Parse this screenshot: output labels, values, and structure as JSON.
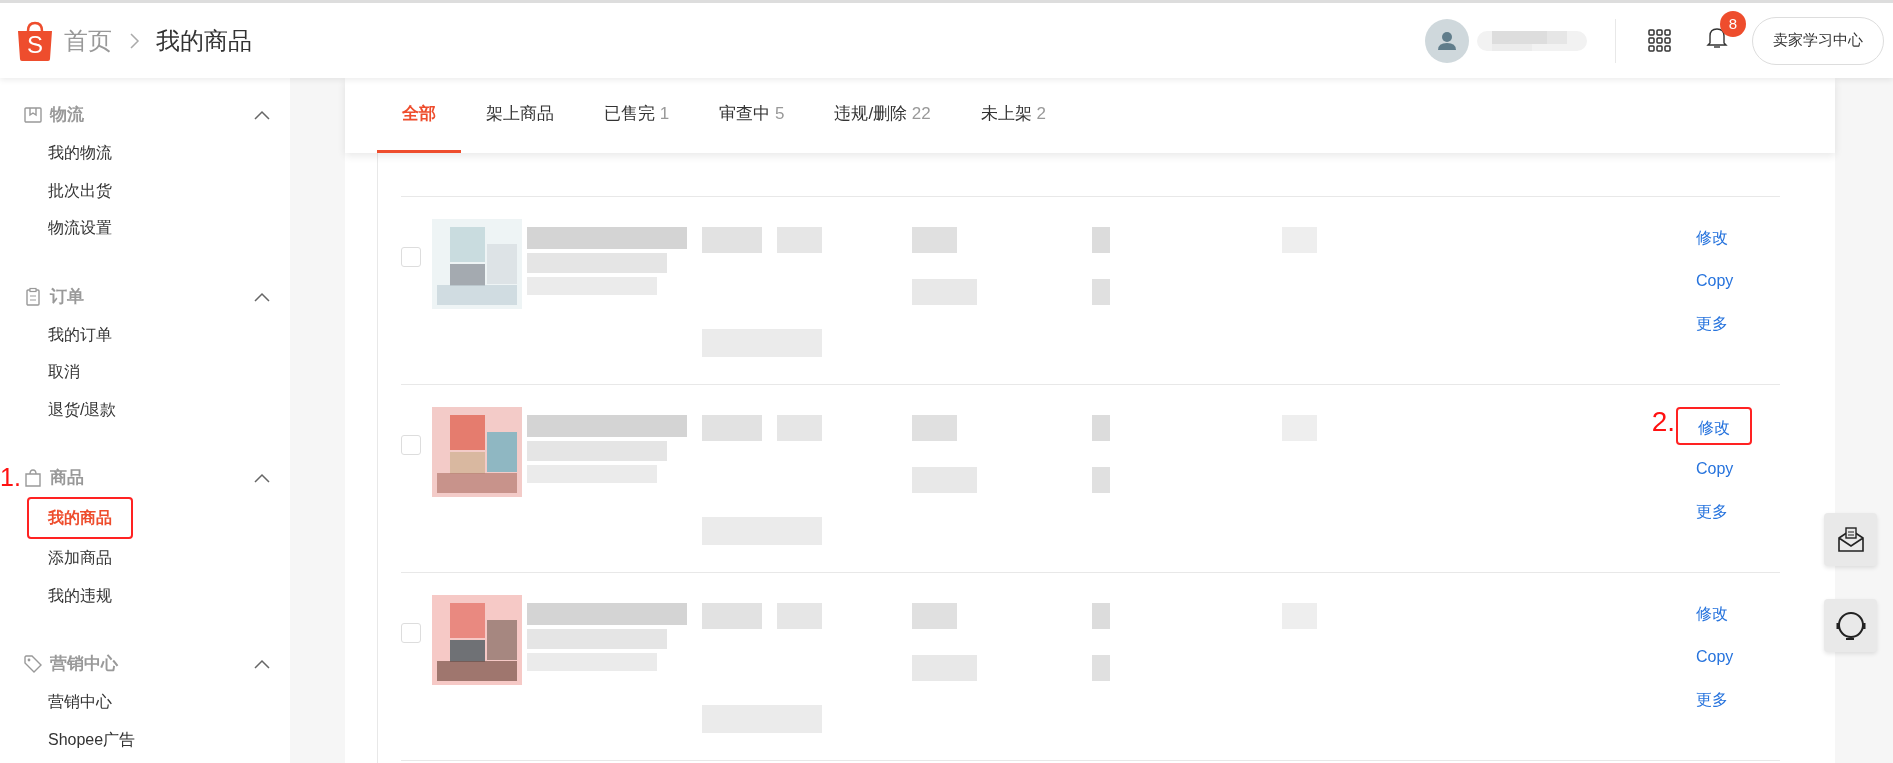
{
  "header": {
    "logo": "S",
    "breadcrumb": [
      {
        "label": "首页"
      },
      {
        "label": "我的商品"
      }
    ],
    "notification_count": "8",
    "learning_button": "卖家学习中心"
  },
  "sidebar": {
    "sections": [
      {
        "kind": "logistics",
        "title": "物流",
        "expanded": true,
        "items": [
          {
            "label": "我的物流",
            "selected": false
          },
          {
            "label": "批次出货",
            "selected": false
          },
          {
            "label": "物流设置",
            "selected": false
          }
        ]
      },
      {
        "kind": "orders",
        "title": "订单",
        "expanded": true,
        "items": [
          {
            "label": "我的订单",
            "selected": false
          },
          {
            "label": "取消",
            "selected": false
          },
          {
            "label": "退货/退款",
            "selected": false
          }
        ]
      },
      {
        "kind": "products",
        "title": "商品",
        "expanded": true,
        "annotation": "1.",
        "items": [
          {
            "label": "我的商品",
            "selected": true,
            "boxed": true
          },
          {
            "label": "添加商品",
            "selected": false
          },
          {
            "label": "我的违规",
            "selected": false
          }
        ]
      },
      {
        "kind": "marketing",
        "title": "营销中心",
        "expanded": true,
        "items": [
          {
            "label": "营销中心",
            "selected": false
          },
          {
            "label": "Shopee广告",
            "selected": false
          }
        ]
      }
    ]
  },
  "tabs": [
    {
      "label": "全部",
      "selected": true
    },
    {
      "label": "架上商品",
      "selected": false
    },
    {
      "label": "已售完",
      "count": "1",
      "selected": false
    },
    {
      "label": "审查中",
      "count": "5",
      "selected": false
    },
    {
      "label": "违规/删除",
      "count": "22",
      "selected": false
    },
    {
      "label": "未上架",
      "count": "2",
      "selected": false
    }
  ],
  "products": [
    {
      "checked": false,
      "actions": [
        {
          "label": "修改"
        },
        {
          "label": "Copy"
        },
        {
          "label": "更多"
        }
      ]
    },
    {
      "checked": false,
      "actions": [
        {
          "label": "修改",
          "annotation": "2."
        },
        {
          "label": "Copy"
        },
        {
          "label": "更多"
        }
      ]
    },
    {
      "checked": false,
      "actions": [
        {
          "label": "修改"
        },
        {
          "label": "Copy"
        },
        {
          "label": "更多"
        }
      ]
    }
  ]
}
